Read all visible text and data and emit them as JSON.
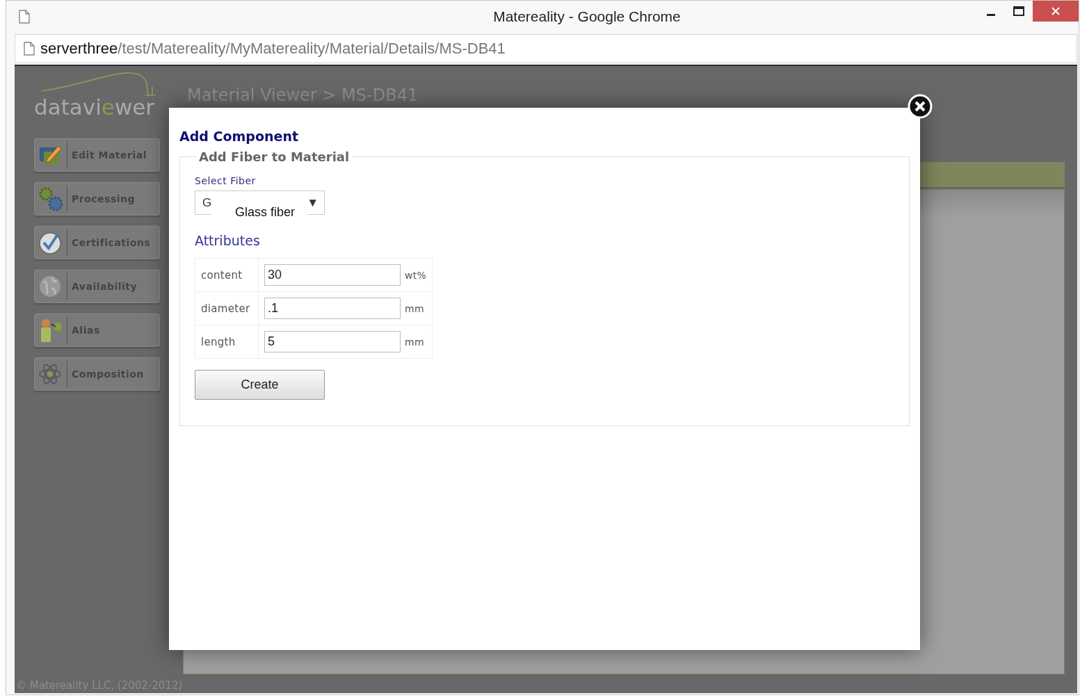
{
  "browser": {
    "title": "Matereality - Google Chrome",
    "url_host": "serverthree",
    "url_path": "/test/Matereality/MyMatereality/Material/Details/MS-DB41"
  },
  "app": {
    "logo": [
      {
        "text": "datavi",
        "accent": false
      },
      {
        "text": "e",
        "accent": true
      },
      {
        "text": "wer",
        "accent": false
      }
    ],
    "breadcrumb": "Material Viewer > MS-DB41",
    "nav": [
      {
        "label": "Edit Material",
        "kind": "edit"
      },
      {
        "label": "Processing",
        "kind": "gears"
      },
      {
        "label": "Certifications",
        "kind": "check"
      },
      {
        "label": "Availability",
        "kind": "globe"
      },
      {
        "label": "Alias",
        "kind": "person"
      },
      {
        "label": "Composition",
        "kind": "atom"
      }
    ],
    "footer": "© Matereality LLC, (2002-2012)"
  },
  "dialog": {
    "title": "Add Component",
    "legend": "Add Fiber to Material",
    "select_label": "Select Fiber",
    "select": {
      "value": "G",
      "arrow": "▼"
    },
    "tooltip": "Glass fiber",
    "attributes_heading": "Attributes",
    "attributes": [
      {
        "name": "content",
        "value": "30",
        "unit": "wt%"
      },
      {
        "name": "diameter",
        "value": ".1",
        "unit": "mm"
      },
      {
        "name": "length",
        "value": "5",
        "unit": "mm"
      }
    ],
    "button": "Create"
  }
}
